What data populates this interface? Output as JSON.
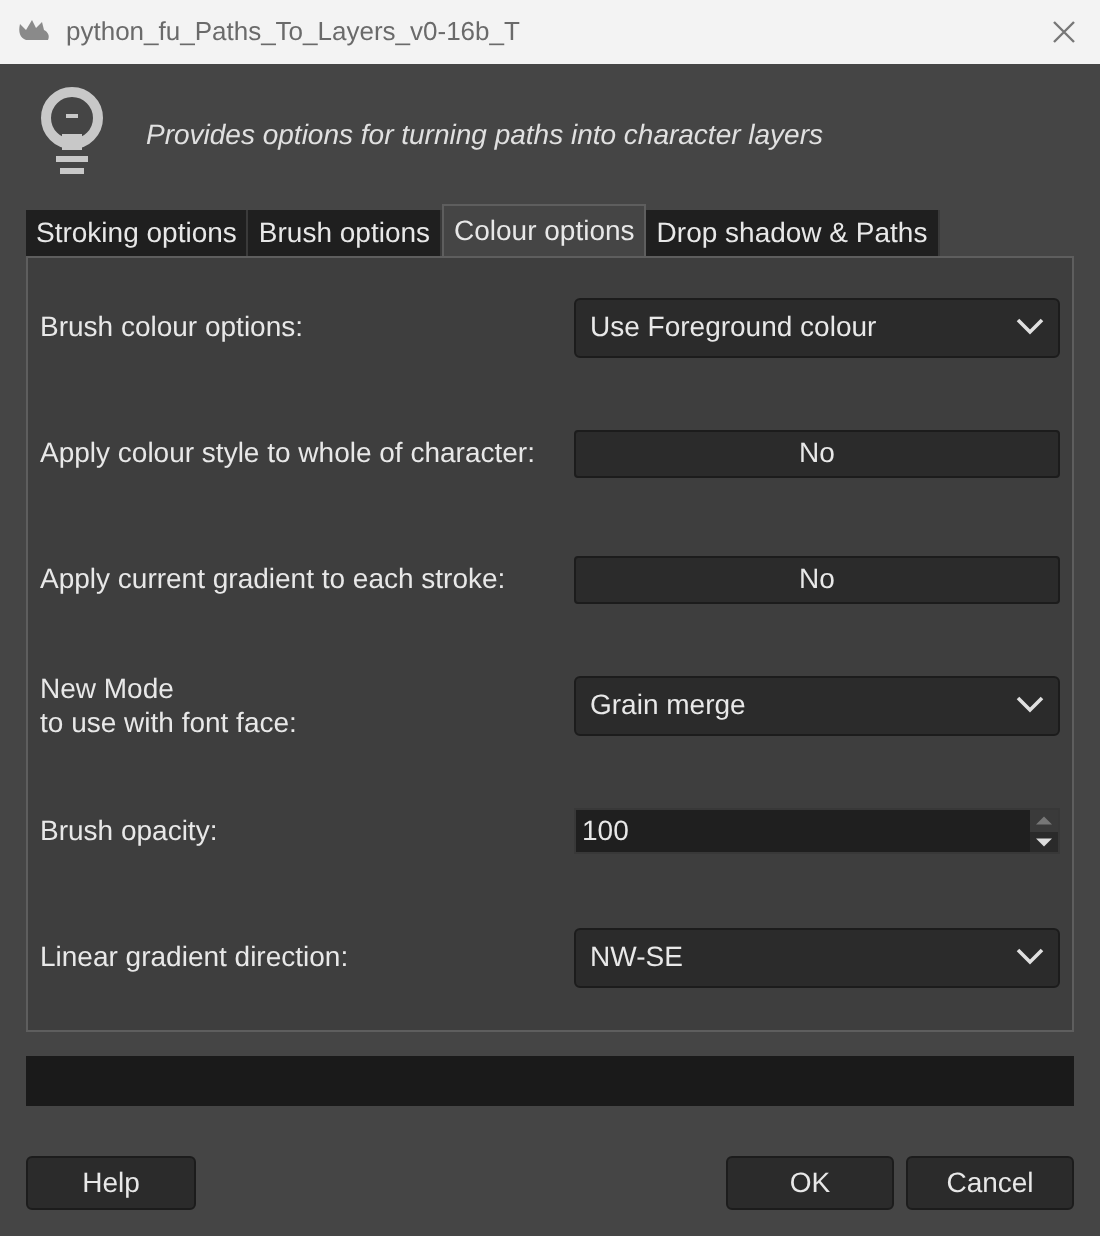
{
  "window": {
    "title": "python_fu_Paths_To_Layers_v0-16b_T"
  },
  "description": "Provides options for turning paths into character layers",
  "tabs": [
    {
      "label": "Stroking options",
      "selected": false
    },
    {
      "label": "Brush options",
      "selected": false
    },
    {
      "label": "Colour options",
      "selected": true
    },
    {
      "label": "Drop shadow & Paths",
      "selected": false
    }
  ],
  "options": [
    {
      "kind": "dropdown",
      "label": "Brush colour options:",
      "value": "Use Foreground colour"
    },
    {
      "kind": "toggle",
      "label": "Apply colour style to whole of character:",
      "value": "No"
    },
    {
      "kind": "toggle",
      "label": "Apply current gradient to each stroke:",
      "value": "No"
    },
    {
      "kind": "dropdown",
      "label": "New Mode\nto use with font face:",
      "value": "Grain merge"
    },
    {
      "kind": "spin",
      "label": "Brush opacity:",
      "value": "100"
    },
    {
      "kind": "dropdown",
      "label": "Linear gradient direction:",
      "value": "NW-SE"
    }
  ],
  "buttons": {
    "help": "Help",
    "ok": "OK",
    "cancel": "Cancel"
  }
}
